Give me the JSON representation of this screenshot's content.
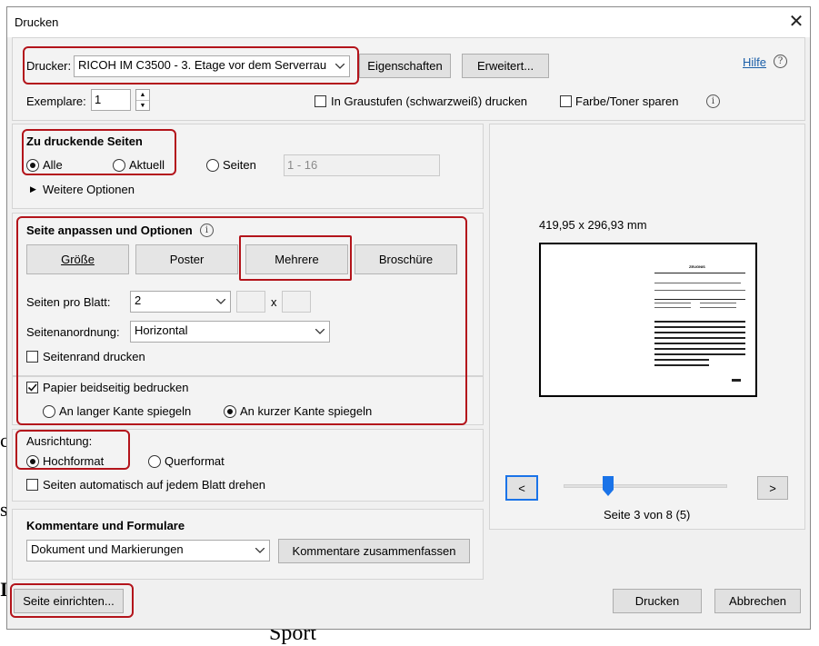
{
  "dialog": {
    "title": "Drucken",
    "help_link": "Hilfe"
  },
  "printer": {
    "label": "Drucker:",
    "selected": "RICOH IM C3500 - 3. Etage vor dem Serverrau",
    "properties_button": "Eigenschaften",
    "advanced_button": "Erweitert..."
  },
  "copies": {
    "label": "Exemplare:",
    "value": "1"
  },
  "options": {
    "grayscale": "In Graustufen (schwarzweiß) drucken",
    "save_ink": "Farbe/Toner sparen"
  },
  "pages": {
    "heading": "Zu druckende Seiten",
    "all": "Alle",
    "current": "Aktuell",
    "pages_label": "Seiten",
    "range_value": "1 - 16",
    "more_options": "Weitere Optionen"
  },
  "sizing": {
    "heading": "Seite anpassen und Optionen",
    "tabs": [
      "Größe",
      "Poster",
      "Mehrere",
      "Broschüre"
    ],
    "pages_per_sheet_label": "Seiten pro Blatt:",
    "pages_per_sheet_value": "2",
    "x_separator": "x",
    "order_label": "Seitenanordnung:",
    "order_value": "Horizontal",
    "print_border": "Seitenrand drucken",
    "duplex": "Papier beidseitig bedrucken",
    "flip_long": "An langer Kante spiegeln",
    "flip_short": "An kurzer Kante spiegeln"
  },
  "orientation": {
    "heading": "Ausrichtung:",
    "portrait": "Hochformat",
    "landscape": "Querformat",
    "auto_rotate": "Seiten automatisch auf jedem Blatt drehen"
  },
  "comments": {
    "heading": "Kommentare und Formulare",
    "selected": "Dokument und Markierungen",
    "summarize_button": "Kommentare zusammenfassen"
  },
  "preview": {
    "size": "419,95 x 296,93 mm",
    "page_status": "Seite 3 von 8 (5)",
    "prev": "<",
    "next": ">",
    "slider_fraction": 0.27,
    "doc_heading": "ZEUGNIS"
  },
  "footer": {
    "page_setup": "Seite einrichten...",
    "print": "Drucken",
    "cancel": "Abbrechen"
  },
  "background": {
    "word": "Sport",
    "fragments": [
      "c",
      "s",
      "I"
    ]
  },
  "colors": {
    "highlight": "#b3141b",
    "link": "#1a5ea8",
    "accent": "#1a73e8"
  }
}
